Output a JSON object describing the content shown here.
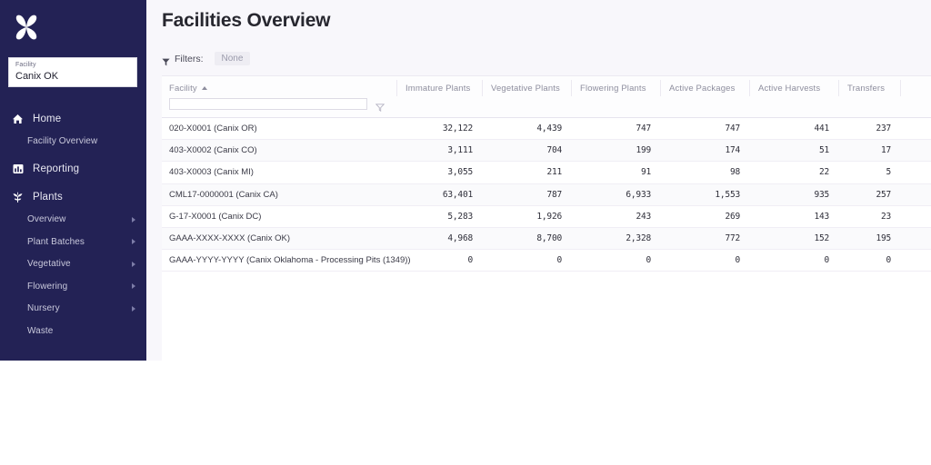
{
  "app": {
    "logo_icon": "canix-butterfly-logo",
    "sidebar_bg": "#232255",
    "page_bg": "#f8f7fb"
  },
  "sidebar": {
    "facility_selector": {
      "label": "Facility",
      "value": "Canix OK"
    },
    "nav": [
      {
        "label": "Home",
        "icon": "home-icon",
        "type": "top"
      },
      {
        "label": "Facility Overview",
        "icon": "",
        "type": "sub",
        "chevron": false
      },
      {
        "label": "Reporting",
        "icon": "reporting-icon",
        "type": "top"
      },
      {
        "label": "Plants",
        "icon": "plant-leaf-icon",
        "type": "top"
      },
      {
        "label": "Overview",
        "icon": "",
        "type": "sub",
        "chevron": true
      },
      {
        "label": "Plant Batches",
        "icon": "",
        "type": "sub",
        "chevron": true
      },
      {
        "label": "Vegetative",
        "icon": "",
        "type": "sub",
        "chevron": true
      },
      {
        "label": "Flowering",
        "icon": "",
        "type": "sub",
        "chevron": true
      },
      {
        "label": "Nursery",
        "icon": "",
        "type": "sub",
        "chevron": true
      },
      {
        "label": "Waste",
        "icon": "",
        "type": "sub",
        "chevron": false
      }
    ]
  },
  "header": {
    "title": "Facilities Overview",
    "filters_icon": "funnel-icon",
    "filters_label": "Filters:",
    "filters_value": "None"
  },
  "table": {
    "sort_column": "Facility",
    "sort_direction": "asc",
    "search_value": "",
    "search_placeholder": "",
    "filter_icon": "funnel-icon",
    "columns": [
      "Facility",
      "Immature Plants",
      "Vegetative Plants",
      "Flowering Plants",
      "Active Packages",
      "Active Harvests",
      "Transfers"
    ],
    "rows": [
      {
        "facility": "020-X0001 (Canix OR)",
        "immature_plants": "32,122",
        "vegetative_plants": "4,439",
        "flowering_plants": "747",
        "active_packages": "747",
        "active_harvests": "441",
        "transfers": "237"
      },
      {
        "facility": "403-X0002 (Canix CO)",
        "immature_plants": "3,111",
        "vegetative_plants": "704",
        "flowering_plants": "199",
        "active_packages": "174",
        "active_harvests": "51",
        "transfers": "17"
      },
      {
        "facility": "403-X0003 (Canix MI)",
        "immature_plants": "3,055",
        "vegetative_plants": "211",
        "flowering_plants": "91",
        "active_packages": "98",
        "active_harvests": "22",
        "transfers": "5"
      },
      {
        "facility": "CML17-0000001 (Canix CA)",
        "immature_plants": "63,401",
        "vegetative_plants": "787",
        "flowering_plants": "6,933",
        "active_packages": "1,553",
        "active_harvests": "935",
        "transfers": "257"
      },
      {
        "facility": "G-17-X0001 (Canix DC)",
        "immature_plants": "5,283",
        "vegetative_plants": "1,926",
        "flowering_plants": "243",
        "active_packages": "269",
        "active_harvests": "143",
        "transfers": "23"
      },
      {
        "facility": "GAAA-XXXX-XXXX (Canix OK)",
        "immature_plants": "4,968",
        "vegetative_plants": "8,700",
        "flowering_plants": "2,328",
        "active_packages": "772",
        "active_harvests": "152",
        "transfers": "195"
      },
      {
        "facility": "GAAA-YYYY-YYYY (Canix Oklahoma - Processing Pits (1349))",
        "immature_plants": "0",
        "vegetative_plants": "0",
        "flowering_plants": "0",
        "active_packages": "0",
        "active_harvests": "0",
        "transfers": "0"
      }
    ]
  }
}
